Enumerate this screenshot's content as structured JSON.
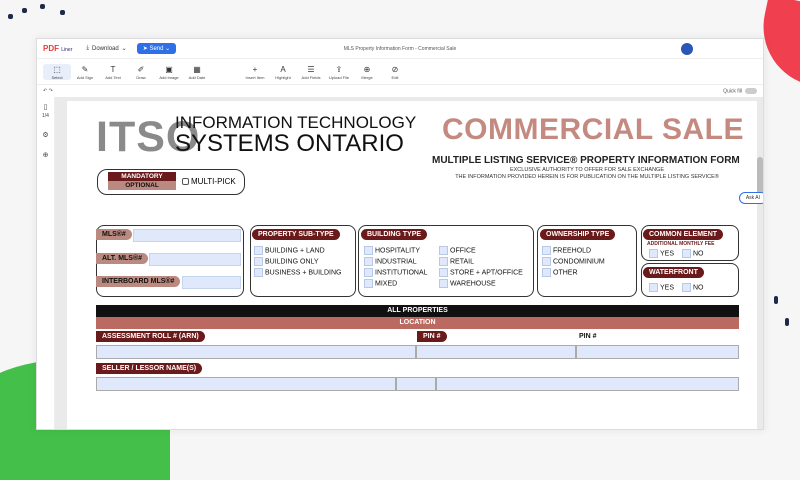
{
  "app": {
    "logo": "PDF",
    "logo_sub": "Liner",
    "download_label": "Download",
    "send_label": "Send",
    "document_title": "MLS Property Information Form - Commercial Sale",
    "ask_ai_label": "Ask AI",
    "quick_fill_label": "Quick fill",
    "left_rail_page": "1/4"
  },
  "toolbar": [
    {
      "label": "Select",
      "icon": "⬚"
    },
    {
      "label": "Add Sign",
      "icon": "✎"
    },
    {
      "label": "Add Text",
      "icon": "T"
    },
    {
      "label": "Draw",
      "icon": "✐"
    },
    {
      "label": "Add Image",
      "icon": "▣"
    },
    {
      "label": "Add Date",
      "icon": "▦"
    },
    {
      "label": "Insert Item",
      "icon": "+"
    },
    {
      "label": "Highlight",
      "icon": "A"
    },
    {
      "label": "Add Fields",
      "icon": "☰"
    },
    {
      "label": "Upload File",
      "icon": "⇪"
    },
    {
      "label": "Merge",
      "icon": "⊕"
    },
    {
      "label": "Edit",
      "icon": "⊘"
    }
  ],
  "form": {
    "itso": "ITSO",
    "org_line1": "INFORMATION TECHNOLOGY",
    "org_line2": "SYSTEMS ONTARIO",
    "mandatory": "MANDATORY",
    "optional": "OPTIONAL",
    "multipick": "MULTI-PICK",
    "title": "COMMERCIAL SALE",
    "subtitle": "MULTIPLE LISTING SERVICE® PROPERTY INFORMATION FORM",
    "exclusive": "EXCLUSIVE AUTHORITY TO OFFER FOR SALE EXCHANGE",
    "info_line": "THE INFORMATION PROVIDED HEREIN IS FOR PUBLICATION ON THE MULTIPLE LISTING SERVICE®",
    "mls_label": "MLS®#",
    "alt_mls_label": "ALT. MLS®#",
    "interboard_label": "INTERBOARD MLS®#",
    "subtype_label": "PROPERTY SUB-TYPE",
    "subtypes": [
      "BUILDING + LAND",
      "BUILDING ONLY",
      "BUSINESS + BUILDING"
    ],
    "building_label": "BUILDING TYPE",
    "building_col1": [
      "HOSPITALITY",
      "INDUSTRIAL",
      "INSTITUTIONAL",
      "MIXED"
    ],
    "building_col2": [
      "OFFICE",
      "RETAIL",
      "STORE + APT/OFFICE",
      "WAREHOUSE"
    ],
    "ownership_label": "OWNERSHIP TYPE",
    "ownership": [
      "FREEHOLD",
      "CONDOMINIUM",
      "OTHER"
    ],
    "common_label": "COMMON ELEMENT",
    "common_sub": "ADDITIONAL MONTHLY FEE",
    "yes": "YES",
    "no": "NO",
    "waterfront_label": "WATERFRONT",
    "all_properties": "ALL PROPERTIES",
    "location": "LOCATION",
    "arn_label": "ASSESSMENT ROLL # (ARN)",
    "pin_label": "PIN #",
    "pin_label2": "PIN #",
    "seller_label": "SELLER / LESSOR NAME(S)"
  }
}
